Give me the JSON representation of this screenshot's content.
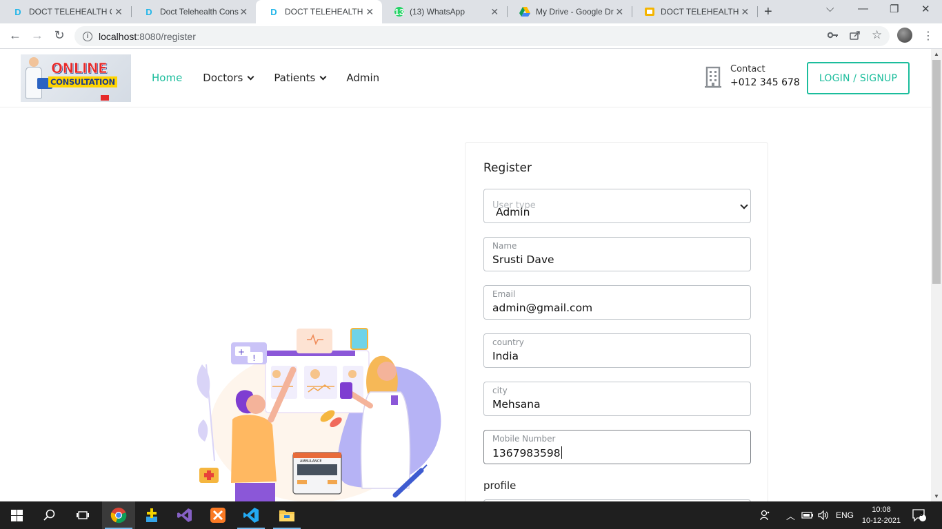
{
  "browser": {
    "tabs": [
      {
        "title": "DOCT TELEHEALTH CC",
        "icon": "d-logo-icon",
        "active": false
      },
      {
        "title": "Doct Telehealth Consu",
        "icon": "d-logo-icon",
        "active": false
      },
      {
        "title": "DOCT TELEHEALTH CC",
        "icon": "d-logo-icon",
        "active": true
      },
      {
        "title": "(13) WhatsApp",
        "icon": "whatsapp-icon",
        "badge": "13",
        "active": false
      },
      {
        "title": "My Drive - Google Dr",
        "icon": "google-drive-icon",
        "active": false
      },
      {
        "title": "DOCT TELEHEALTH CC",
        "icon": "google-slides-icon",
        "active": false
      }
    ],
    "url_host": "localhost",
    "url_path": ":8080/register"
  },
  "site": {
    "logo_line1": "ONLINE",
    "logo_line2": "CONSULTATION",
    "nav": [
      {
        "label": "Home",
        "active": true,
        "dropdown": false
      },
      {
        "label": "Doctors",
        "active": false,
        "dropdown": true
      },
      {
        "label": "Patients",
        "active": false,
        "dropdown": true
      },
      {
        "label": "Admin",
        "active": false,
        "dropdown": false
      }
    ],
    "contact_label": "Contact",
    "contact_phone": "+012 345 678",
    "login_label": "LOGIN / SIGNUP",
    "accent_color": "#1bbd9c"
  },
  "form": {
    "title": "Register",
    "user_type": {
      "label": "User type",
      "value": "Admin"
    },
    "name": {
      "label": "Name",
      "value": "Srusti Dave"
    },
    "email": {
      "label": "Email",
      "value": "admin@gmail.com"
    },
    "country": {
      "label": "country",
      "value": "India"
    },
    "city": {
      "label": "city",
      "value": "Mehsana"
    },
    "mobile": {
      "label": "Mobile Number",
      "value": "1367983598"
    },
    "profile_label": "profile"
  },
  "illustration": {
    "ambulance_text": "AMBULANCE"
  },
  "taskbar": {
    "language": "ENG",
    "time": "10:08",
    "date": "10-12-2021",
    "notification_count": "3"
  }
}
